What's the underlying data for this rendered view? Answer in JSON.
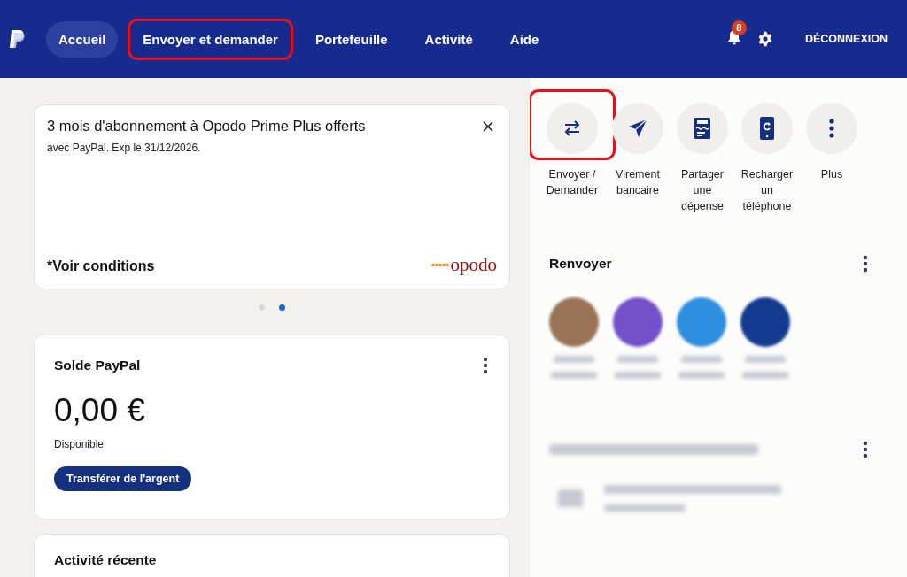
{
  "nav": {
    "items": [
      {
        "label": "Accueil",
        "selected": true,
        "highlighted": false
      },
      {
        "label": "Envoyer et demander",
        "selected": false,
        "highlighted": true
      },
      {
        "label": "Portefeuille",
        "selected": false,
        "highlighted": false
      },
      {
        "label": "Activité",
        "selected": false,
        "highlighted": false
      },
      {
        "label": "Aide",
        "selected": false,
        "highlighted": false
      }
    ],
    "notifications": "8",
    "logout": "DÉCONNEXION"
  },
  "promo": {
    "title": "3 mois d'abonnement à Opodo Prime Plus offerts",
    "subtitle": "avec PayPal. Exp le 31/12/2026.",
    "terms": "*Voir conditions",
    "brand": "opodo",
    "pages": [
      {
        "selected": false
      },
      {
        "selected": true
      }
    ]
  },
  "balance": {
    "title": "Solde PayPal",
    "amount": "0,00 €",
    "caption": "Disponible",
    "button": "Transférer de l'argent"
  },
  "recent": {
    "title": "Activité récente"
  },
  "actions": [
    {
      "kind": "transfer",
      "label": "Envoyer / Demander",
      "highlighted": true
    },
    {
      "kind": "send",
      "label": "Virement bancaire",
      "highlighted": false
    },
    {
      "kind": "split",
      "label": "Partager une dépense",
      "highlighted": false
    },
    {
      "kind": "topup",
      "label": "Recharger un téléphone",
      "highlighted": false
    },
    {
      "kind": "more",
      "label": "Plus",
      "highlighted": false
    }
  ],
  "resend": {
    "title": "Renvoyer",
    "contacts": [
      {
        "color": "#9a7458"
      },
      {
        "color": "#7250c8"
      },
      {
        "color": "#2e8ee0"
      },
      {
        "color": "#123a8e"
      }
    ]
  }
}
